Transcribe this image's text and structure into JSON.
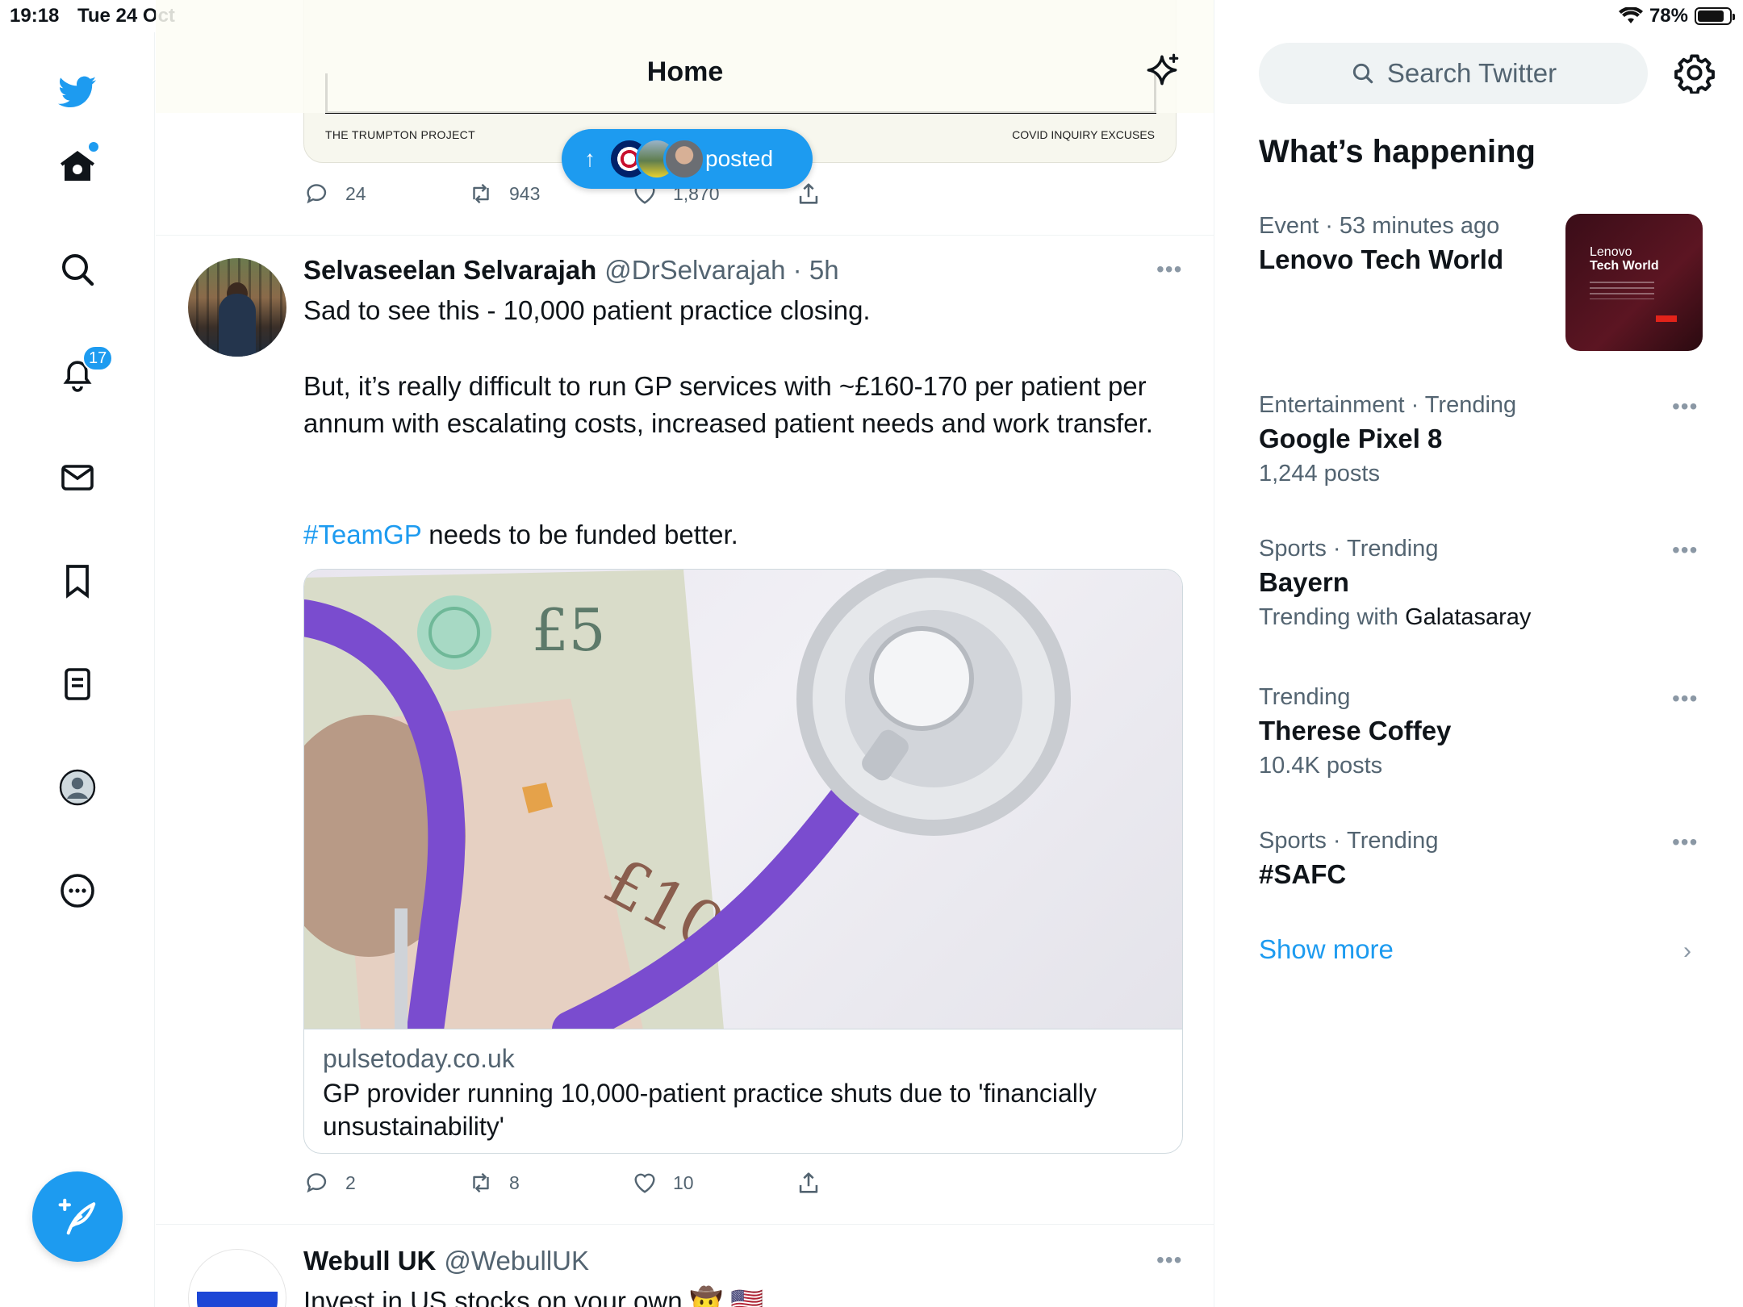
{
  "status_bar": {
    "time": "19:18",
    "date": "Tue 24 Oct",
    "battery": "78%",
    "battery_level": 0.78
  },
  "nav": {
    "notifications_badge": "17"
  },
  "header": {
    "title": "Home"
  },
  "prev_tweet": {
    "card_left": "THE TRUMPTON PROJECT",
    "card_right": "COVID INQUIRY EXCUSES",
    "replies": "24",
    "retweets": "943",
    "likes": "1,870"
  },
  "posted_pill": {
    "label": "posted"
  },
  "tweet": {
    "name": "Selvaseelan Selvarajah",
    "handle": "@DrSelvarajah · 5h",
    "line1": "Sad to see this - 10,000 patient practice closing.",
    "paragraph2": "But, it’s really difficult to run GP services with ~£160-170 per patient per annum with escalating costs, increased patient needs and work transfer.",
    "hashtag": "#TeamGP",
    "line3_rest": " needs to be funded better.",
    "link_domain": "pulsetoday.co.uk",
    "link_title": "GP provider running 10,000-patient practice shuts due to 'financially unsustainability'",
    "replies": "2",
    "retweets": "8",
    "likes": "10"
  },
  "next_tweet": {
    "name": "Webull UK",
    "handle": "@WebullUK",
    "text": "Invest in US stocks on your own 🤠 🇺🇸"
  },
  "sidebar": {
    "search_placeholder": "Search Twitter",
    "title": "What’s happening",
    "trends": [
      {
        "category": "Event · 53 minutes ago",
        "title": "Lenovo Tech World",
        "sub": ""
      },
      {
        "category": "Entertainment · Trending",
        "title": "Google Pixel 8",
        "sub": "1,244 posts"
      },
      {
        "category": "Sports · Trending",
        "title": "Bayern",
        "sub_prefix": "Trending with ",
        "sub_name": "Galatasaray"
      },
      {
        "category": "Trending",
        "title": "Therese Coffey",
        "sub": "10.4K posts"
      },
      {
        "category": "Sports · Trending",
        "title": "#SAFC",
        "sub": ""
      }
    ],
    "event_thumb": {
      "line1": "Lenovo",
      "line2": "Tech World"
    },
    "show_more": "Show more"
  }
}
